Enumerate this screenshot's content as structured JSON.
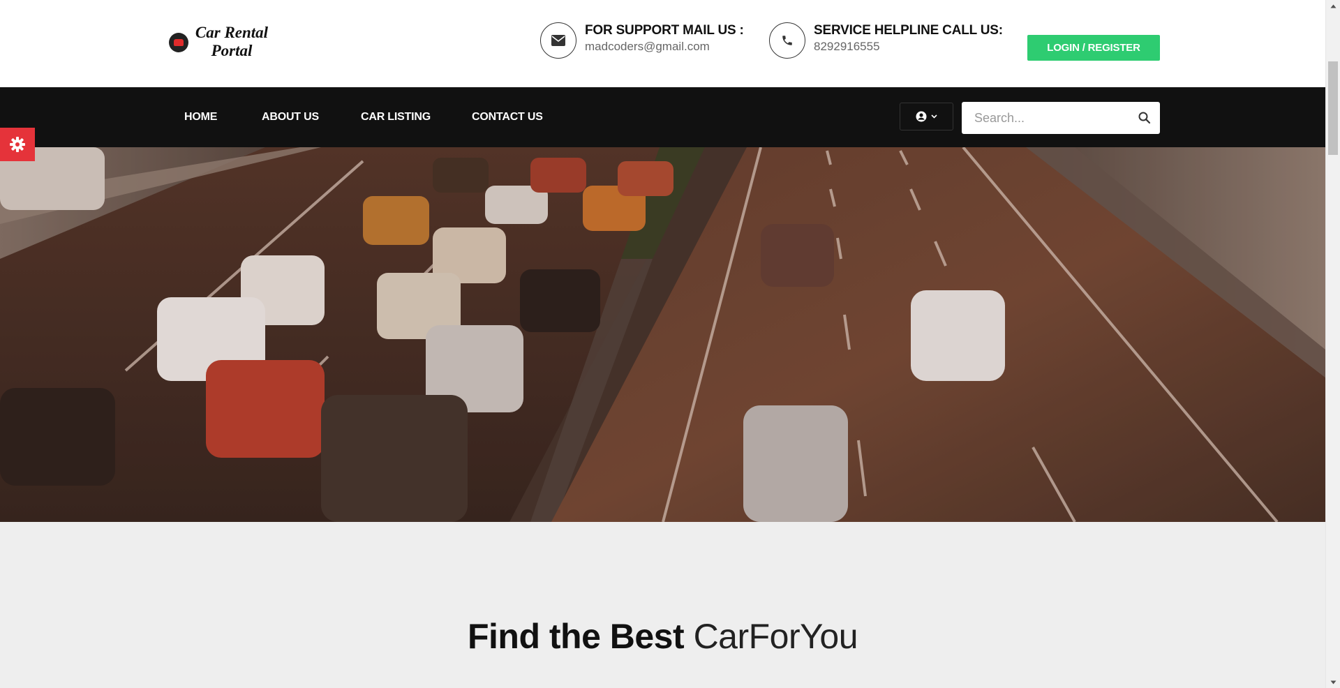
{
  "header": {
    "logo_text": "Car Rental Portal",
    "support": {
      "title": "FOR SUPPORT MAIL US :",
      "value": "madcoders@gmail.com",
      "icon": "envelope-icon"
    },
    "helpline": {
      "title": "SERVICE HELPLINE CALL US:",
      "value": "8292916555",
      "icon": "phone-icon"
    },
    "login_label": "LOGIN / REGISTER"
  },
  "nav": {
    "items": [
      {
        "label": "HOME"
      },
      {
        "label": "ABOUT US"
      },
      {
        "label": "CAR LISTING"
      },
      {
        "label": "CONTACT US"
      }
    ],
    "user_icon": "user-circle-icon",
    "search": {
      "placeholder": "Search...",
      "icon": "search-icon"
    }
  },
  "settings": {
    "icon": "gear-icon"
  },
  "hero": {
    "image": "highway-traffic-at-dusk",
    "alt": "Aerial view of cars on a multi-lane highway at dusk"
  },
  "section": {
    "title_bold": "Find the Best",
    "title_light": "CarForYou"
  },
  "colors": {
    "accent_green": "#2ecc71",
    "nav_bg": "#111111",
    "settings_red": "#e5333a",
    "section_bg": "#eeeeee"
  }
}
